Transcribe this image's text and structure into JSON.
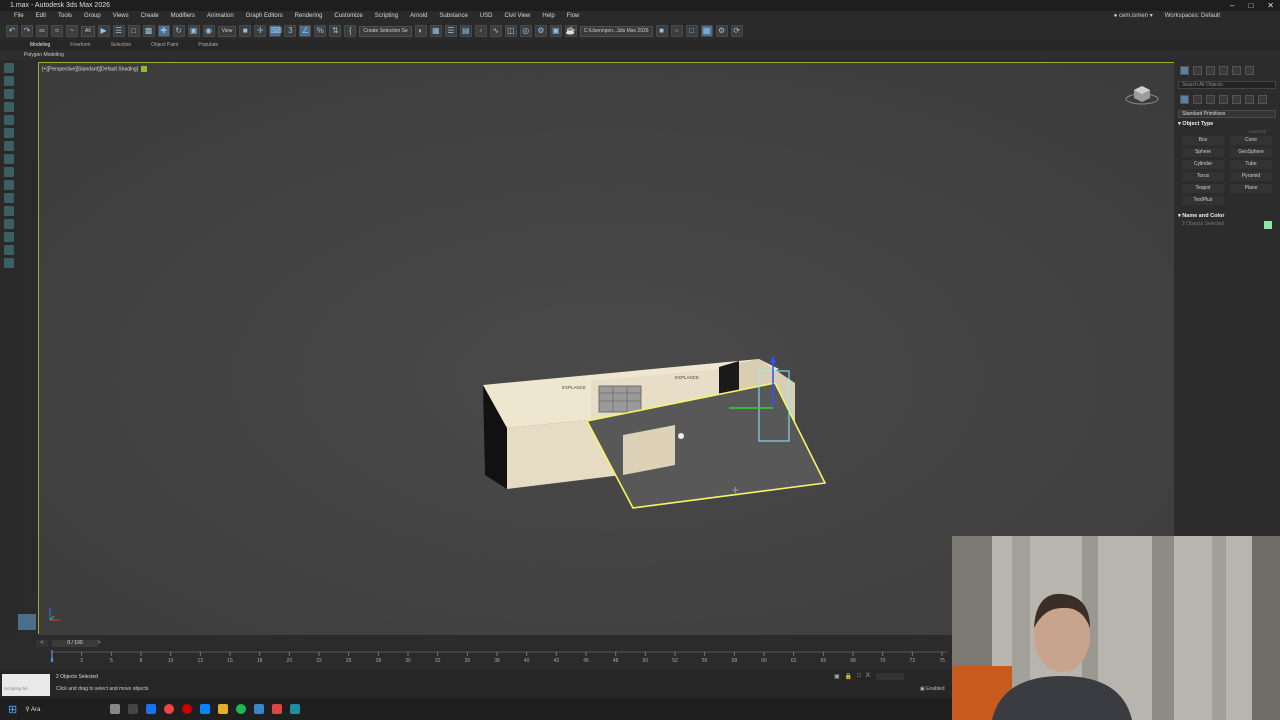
{
  "window": {
    "title": "1.max - Autodesk 3ds Max 2026"
  },
  "menu": [
    "File",
    "Edit",
    "Tools",
    "Group",
    "Views",
    "Create",
    "Modifiers",
    "Animation",
    "Graph Editors",
    "Rendering",
    "Customize",
    "Scripting",
    "Arnold",
    "Substance",
    "USD",
    "Civil View",
    "Help",
    "Flow"
  ],
  "account": {
    "user": "cem.ismen",
    "workspaces_label": "Workspaces:",
    "workspace": "Default"
  },
  "toolbar": {
    "filter": "All",
    "view_dropdown": "View",
    "selection_set": "Create Selection Se",
    "project_path": "C:\\Users\\pen...3ds Max 2026"
  },
  "ribbon": {
    "tabs": [
      "Modeling",
      "Freeform",
      "Selection",
      "Object Paint",
      "Populate"
    ],
    "active": "Modeling",
    "sub_label": "Polygon Modeling"
  },
  "viewport": {
    "label": "[+][Perspective][Standard][Default Shading]"
  },
  "command_panel": {
    "search_placeholder": "Search All Objects",
    "category": "Standard Primitives",
    "object_type_title": "Object Type",
    "autogrid": "AutoGrid",
    "buttons": [
      "Box",
      "Cone",
      "Sphere",
      "GeoSphere",
      "Cylinder",
      "Tube",
      "Torus",
      "Pyramid",
      "Teapot",
      "Plane",
      "TextPlus"
    ],
    "name_color_title": "Name and Color",
    "selected_text": "2 Objects Selected",
    "swatch_color": "#8fe6a5"
  },
  "timeline": {
    "slider_label": "0 / 100",
    "ticks": [
      "0",
      "2",
      "5",
      "8",
      "10",
      "12",
      "15",
      "18",
      "20",
      "22",
      "25",
      "28",
      "30",
      "32",
      "35",
      "38",
      "40",
      "42",
      "45",
      "48",
      "50",
      "52",
      "55",
      "58",
      "60",
      "62",
      "65",
      "68",
      "70",
      "72",
      "75"
    ]
  },
  "status": {
    "selected": "2 Objects Selected",
    "hint": "Click and drag to select and move objects",
    "scripting": "Scripting Mi",
    "enabled": "Enabled"
  },
  "taskbar": {
    "search": "Ara"
  },
  "scene": {
    "sign_text": "EXPLANCE"
  }
}
